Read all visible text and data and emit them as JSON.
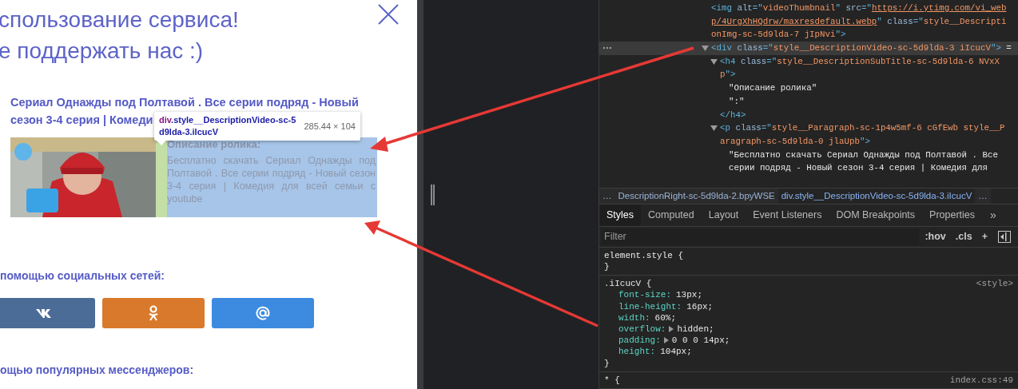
{
  "page": {
    "title_lines": [
      "спользование сервиса!",
      "е поддержать нас :)"
    ],
    "video_title_lines": [
      "Сериал Однажды под Полтавой . Все серии подряд - Новый",
      "сезон 3-4 серия | Комеди"
    ],
    "video_card": {
      "highlighted": true,
      "subtitle": "Описание ролика:",
      "description": "Бесплатно скачать Сериал Однажды под Полтавой . Все серии подряд - Новый сезон 3-4 серия | Комедия для всей семьи с youtube"
    },
    "social_heading": "помощью социальных сетей:",
    "share_buttons": [
      {
        "kind": "vk",
        "color": "#4c6c98"
      },
      {
        "kind": "ok",
        "color": "#d9792b"
      },
      {
        "kind": "mail",
        "color": "#3d8be0"
      }
    ],
    "messengers_heading": "ощью популярных мессенджеров:"
  },
  "inspect_tooltip": {
    "tag": "div",
    "selector_lines": [
      ".style__DescriptionVideo-sc-5",
      "d9lda-3.iIcucV"
    ],
    "size": "285.44 × 104"
  },
  "elements_tree": [
    {
      "selected": false,
      "lines": [
        [
          {
            "kind": "tag",
            "text": "<img "
          },
          {
            "kind": "attr",
            "text": "alt"
          },
          {
            "kind": "tag",
            "text": "=\""
          },
          {
            "kind": "value",
            "text": "videoThumbnail"
          },
          {
            "kind": "tag",
            "text": "\" "
          },
          {
            "kind": "attr",
            "text": "src"
          },
          {
            "kind": "tag",
            "text": "=\""
          },
          {
            "kind": "link",
            "text": "https://i.ytimg.com/vi_web"
          }
        ],
        [
          {
            "kind": "link",
            "text": "p/4UrgXhHQdrw/maxresdefault.webp"
          },
          {
            "kind": "tag",
            "text": "\" "
          },
          {
            "kind": "attr",
            "text": "class"
          },
          {
            "kind": "tag",
            "text": "=\""
          },
          {
            "kind": "value",
            "text": "style__Descripti"
          }
        ],
        [
          {
            "kind": "value",
            "text": "onImg-sc-5d9lda-7 jIpNvi"
          },
          {
            "kind": "tag",
            "text": "\">"
          }
        ]
      ]
    },
    {
      "selected": true,
      "expanded": true,
      "lines": [
        [
          {
            "kind": "tag",
            "text": "<div "
          },
          {
            "kind": "attr",
            "text": "class"
          },
          {
            "kind": "tag",
            "text": "=\""
          },
          {
            "kind": "value",
            "text": "style__DescriptionVideo-sc-5d9lda-3 iIcucV"
          },
          {
            "kind": "tag",
            "text": "\">"
          },
          {
            "kind": "text",
            "text": " ="
          }
        ]
      ],
      "children": [
        {
          "selected": false,
          "expanded": true,
          "lines": [
            [
              {
                "kind": "tag",
                "text": "<h4 "
              },
              {
                "kind": "attr",
                "text": "class"
              },
              {
                "kind": "tag",
                "text": "=\""
              },
              {
                "kind": "value",
                "text": "style__DescriptionSubTitle-sc-5d9lda-6 NVxX"
              }
            ],
            [
              {
                "kind": "value",
                "text": "p"
              },
              {
                "kind": "tag",
                "text": "\">"
              }
            ]
          ],
          "children": [
            {
              "selected": false,
              "lines": [
                [
                  {
                    "kind": "text",
                    "text": "\"Описание ролика\""
                  }
                ]
              ]
            },
            {
              "selected": false,
              "lines": [
                [
                  {
                    "kind": "text",
                    "text": "\":\""
                  }
                ]
              ]
            }
          ],
          "closing": [
            {
              "kind": "tag",
              "text": "</h4>"
            }
          ]
        },
        {
          "selected": false,
          "expanded": true,
          "lines": [
            [
              {
                "kind": "tag",
                "text": "<p "
              },
              {
                "kind": "attr",
                "text": "class"
              },
              {
                "kind": "tag",
                "text": "=\""
              },
              {
                "kind": "value",
                "text": "style__Paragraph-sc-1p4w5mf-6 cGfEwb style__P"
              }
            ],
            [
              {
                "kind": "value",
                "text": "aragraph-sc-5d9lda-0 jlaUpb"
              },
              {
                "kind": "tag",
                "text": "\">"
              }
            ]
          ],
          "children": [
            {
              "selected": false,
              "lines": [
                [
                  {
                    "kind": "text",
                    "text": "\"Бесплатно скачать Сериал Однажды под Полтавой . Все"
                  }
                ],
                [
                  {
                    "kind": "text",
                    "text": "серии подряд - Новый сезон 3-4 серия | Комедия для"
                  }
                ]
              ]
            }
          ]
        }
      ]
    }
  ],
  "breadcrumbs": [
    {
      "label": "…",
      "selected": false
    },
    {
      "label": "DescriptionRight-sc-5d9lda-2.bpyWSE",
      "selected": false
    },
    {
      "label": "div.style__DescriptionVideo-sc-5d9lda-3.iIcucV",
      "selected": true
    },
    {
      "label": "…",
      "selected": false
    }
  ],
  "sidebar_tabs": [
    {
      "label": "Styles",
      "selected": true
    },
    {
      "label": "Computed",
      "selected": false
    },
    {
      "label": "Layout",
      "selected": false
    },
    {
      "label": "Event Listeners",
      "selected": false
    },
    {
      "label": "DOM Breakpoints",
      "selected": false
    },
    {
      "label": "Properties",
      "selected": false
    }
  ],
  "more_tabs": "»",
  "filter": {
    "placeholder": "Filter",
    "buttons": [
      ":hov",
      ".cls",
      "+"
    ]
  },
  "rules": [
    {
      "selector": "element.style {",
      "close": "}"
    },
    {
      "selector": ".iIcucV {",
      "source": "<style>",
      "properties": [
        {
          "name": "font-size:",
          "value": "13px;",
          "expandable": false
        },
        {
          "name": "line-height:",
          "value": "16px;",
          "expandable": false
        },
        {
          "name": "width:",
          "value": "60%;",
          "expandable": false
        },
        {
          "name": "overflow:",
          "value": "hidden;",
          "expandable": true
        },
        {
          "name": "padding:",
          "value": "0 0 0 14px;",
          "expandable": true
        },
        {
          "name": "height:",
          "value": "104px;",
          "expandable": false
        }
      ],
      "close": "}"
    },
    {
      "selector": "* {",
      "source": "index.css:49"
    }
  ]
}
